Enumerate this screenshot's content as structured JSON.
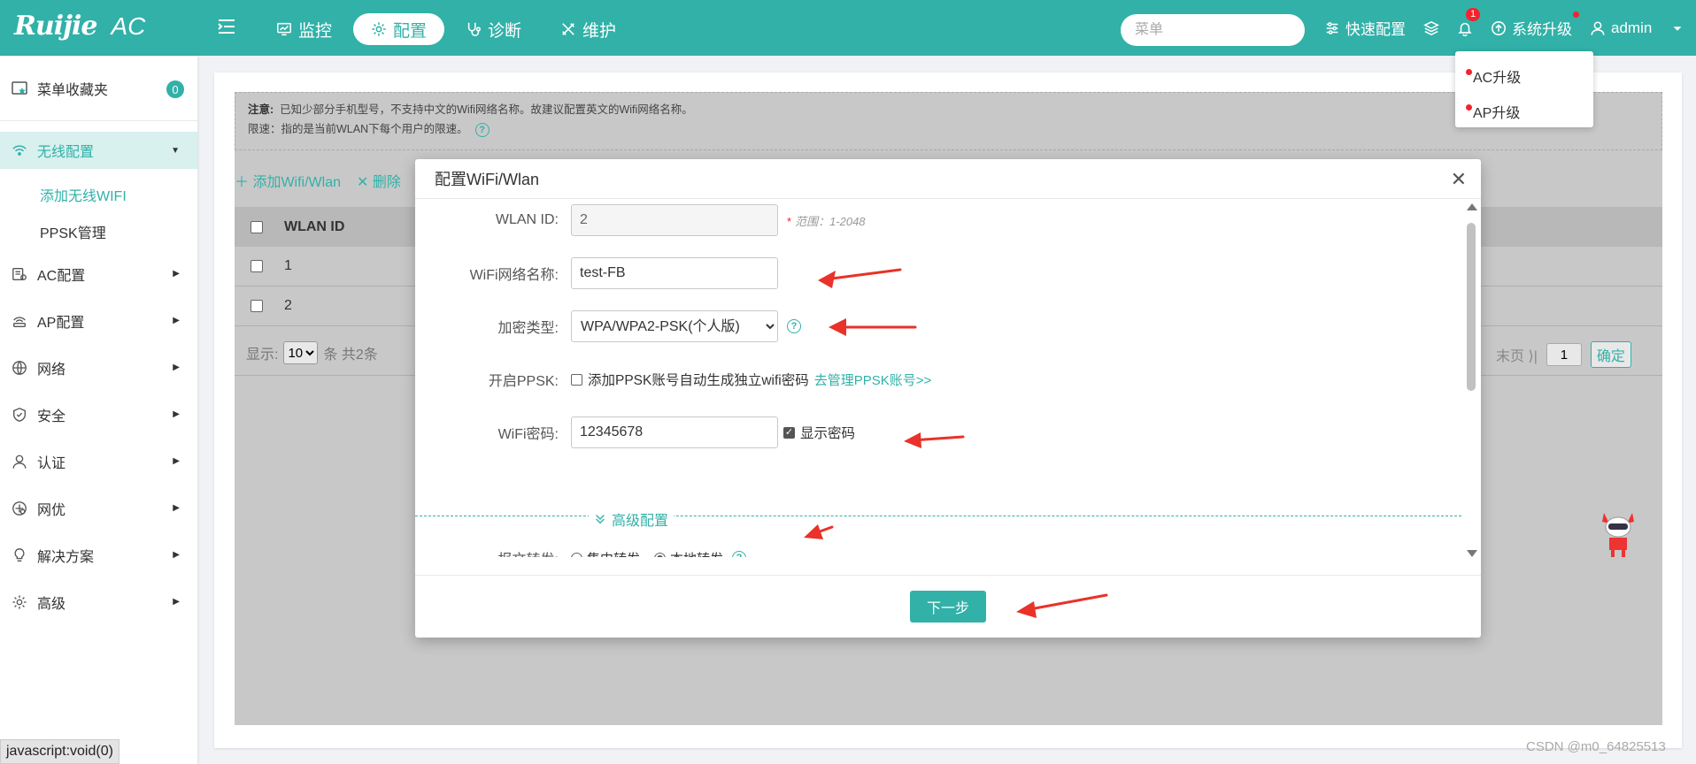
{
  "topbar": {
    "brand": "Ruijie",
    "product": "AC",
    "nav": [
      {
        "label": "监控",
        "icon": "monitor-icon",
        "active": false
      },
      {
        "label": "配置",
        "icon": "gear-icon",
        "active": true
      },
      {
        "label": "诊断",
        "icon": "stethoscope-icon",
        "active": false
      },
      {
        "label": "维护",
        "icon": "tools-icon",
        "active": false
      }
    ],
    "search_placeholder": "菜单",
    "quick_config": "快速配置",
    "notification_count": "1",
    "system_upgrade": "系统升级",
    "user": "admin"
  },
  "upgrade_menu": [
    "AC升级",
    "AP升级"
  ],
  "sidebar": {
    "favorites_label": "菜单收藏夹",
    "favorites_count": "0",
    "wireless_label": "无线配置",
    "wireless_sub": [
      "添加无线WIFI",
      "PPSK管理"
    ],
    "items": [
      "AC配置",
      "AP配置",
      "网络",
      "安全",
      "认证",
      "网优",
      "解决方案",
      "高级"
    ]
  },
  "notice": {
    "note_title": "注意:",
    "note_text": "已知少部分手机型号，不支持中文的Wifi网络名称。故建议配置英文的Wifi网络名称。",
    "limit_text": "限速：指的是当前WLAN下每个用户的限速。"
  },
  "toolbar": {
    "add": "添加Wifi/Wlan",
    "delete": "删除"
  },
  "table": {
    "header": "WLAN ID",
    "rows": [
      "1",
      "2"
    ]
  },
  "pager": {
    "show": "显示:",
    "page_size": "10",
    "total": "条 共2条",
    "last": "末页",
    "page": "1",
    "confirm": "确定"
  },
  "modal": {
    "title": "配置WiFi/Wlan",
    "wlan_id_label": "WLAN ID:",
    "wlan_id_value": "2",
    "wlan_id_hint": "范围：1-2048",
    "ssid_label": "WiFi网络名称:",
    "ssid_value": "test-FB",
    "enc_label": "加密类型:",
    "enc_value": "WPA/WPA2-PSK(个人版)",
    "ppsk_label": "开启PPSK:",
    "ppsk_text": "添加PPSK账号自动生成独立wifi密码",
    "ppsk_link": "去管理PPSK账号>>",
    "pwd_label": "WiFi密码:",
    "pwd_value": "12345678",
    "show_pwd": "显示密码",
    "advanced": "高级配置",
    "fwd_label": "报文转发:",
    "fwd_central": "集中转发",
    "fwd_local": "本地转发",
    "next": "下一步"
  },
  "status_tip": "javascript:void(0)",
  "watermark": "CSDN @m0_64825513"
}
